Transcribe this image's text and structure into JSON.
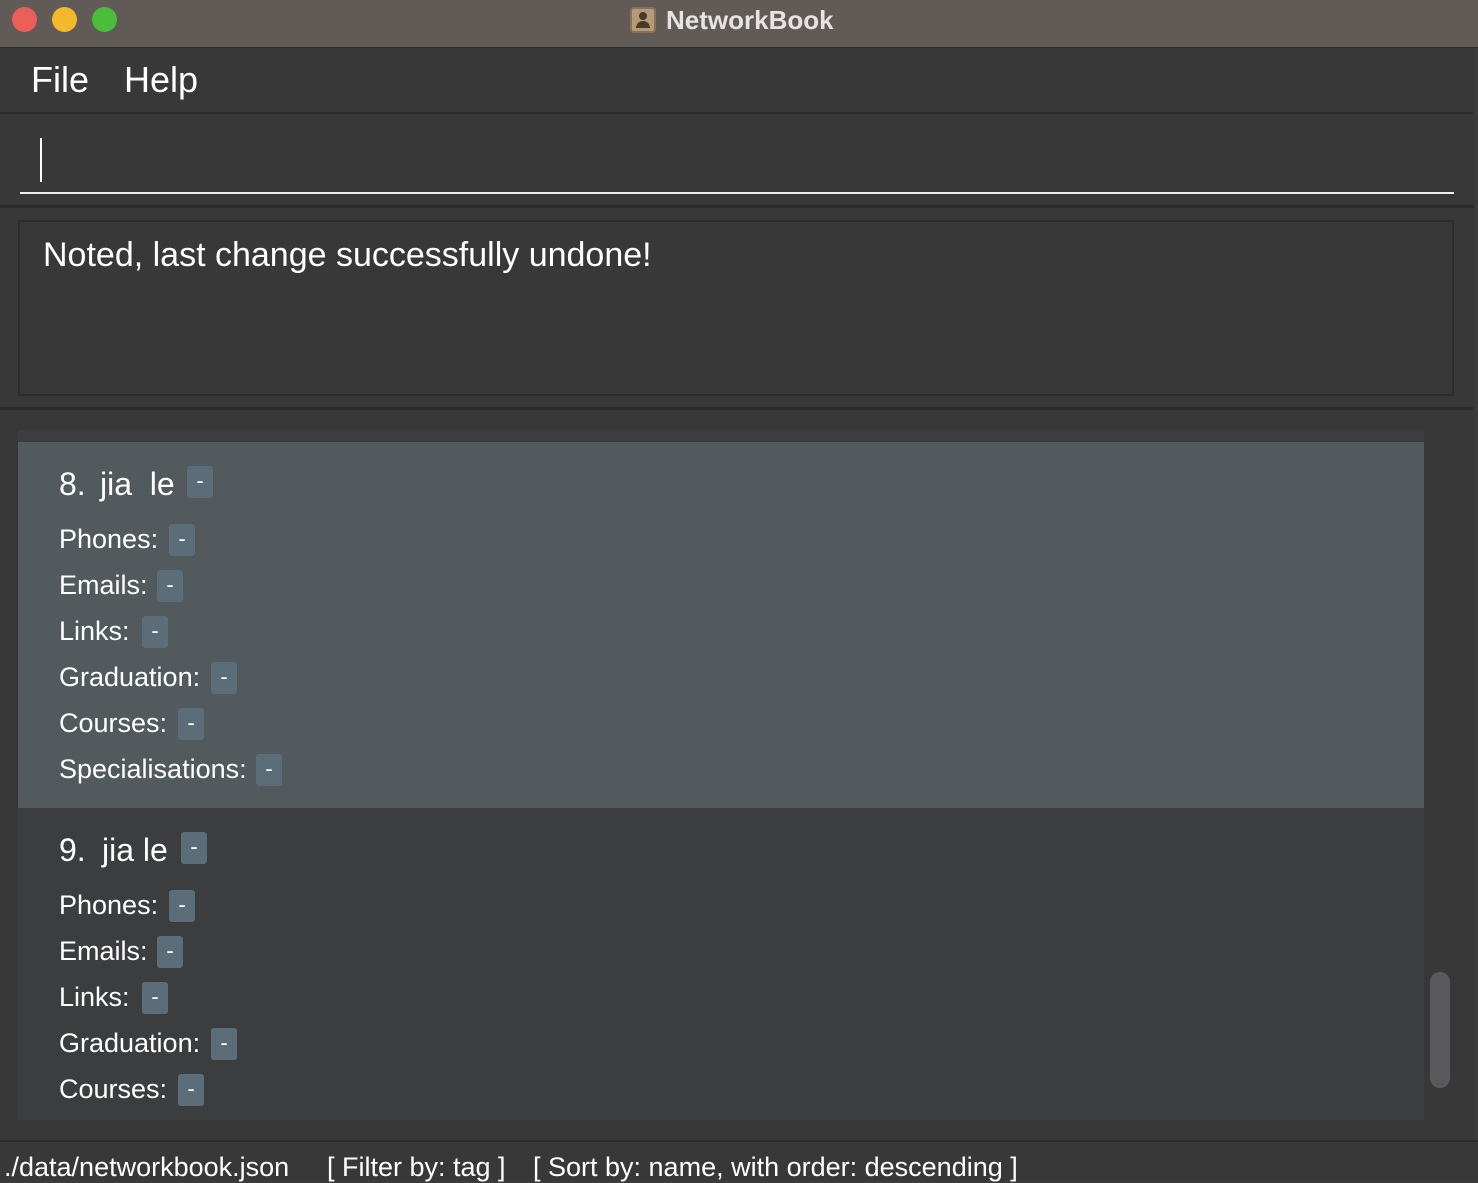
{
  "window": {
    "title": "NetworkBook"
  },
  "menu": {
    "file": "File",
    "help": "Help"
  },
  "command": {
    "value": "",
    "placeholder": ""
  },
  "result": {
    "message": "Noted, last change successfully undone!"
  },
  "persons": [
    {
      "index": "8.",
      "name": "jia  le",
      "tag": "-",
      "fields": [
        {
          "label": "Phones:",
          "value": "-"
        },
        {
          "label": "Emails:",
          "value": "-"
        },
        {
          "label": "Links:",
          "value": "-"
        },
        {
          "label": "Graduation:",
          "value": "-"
        },
        {
          "label": "Courses:",
          "value": "-"
        },
        {
          "label": "Specialisations:",
          "value": "-"
        }
      ]
    },
    {
      "index": "9.",
      "name": "jia le",
      "tag": "-",
      "fields": [
        {
          "label": "Phones:",
          "value": "-"
        },
        {
          "label": "Emails:",
          "value": "-"
        },
        {
          "label": "Links:",
          "value": "-"
        },
        {
          "label": "Graduation:",
          "value": "-"
        },
        {
          "label": "Courses:",
          "value": "-"
        }
      ]
    }
  ],
  "status": {
    "file_path": "./data/networkbook.json",
    "filter": "[ Filter by: tag ]",
    "sort": "[ Sort by: name, with order: descending ]"
  },
  "colors": {
    "selected_card": "#525a5e",
    "tag_background": "#5a6d78",
    "titlebar": "#615b58"
  }
}
